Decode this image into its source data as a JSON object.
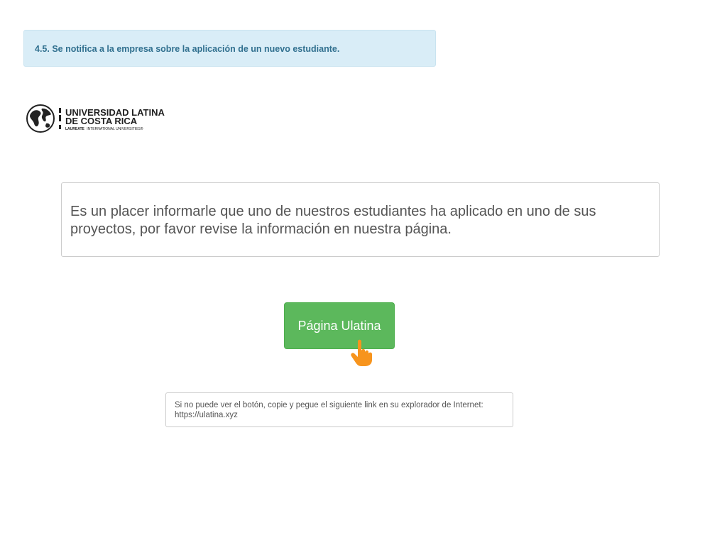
{
  "banner": {
    "text": "4.5. Se notifica a la empresa sobre la aplicación de un nuevo estudiante."
  },
  "logo": {
    "line1": "UNIVERSIDAD LATINA",
    "line2": "DE COSTA RICA",
    "tagline_bold": "LAUREATE",
    "tagline_rest": "INTERNATIONAL UNIVERSITIES®",
    "icon": "globe-icon"
  },
  "message": {
    "text": "Es un placer informarle que uno de nuestros estudiantes ha aplicado en uno de sus proyectos, por favor revise la información en nuestra página."
  },
  "cta": {
    "label": "Página Ulatina",
    "pointer_icon": "hand-pointer-icon",
    "color": "#5cb85c"
  },
  "fallback": {
    "instructions": "Si no puede ver el botón, copie y pegue el siguiente link en su explorador de Internet:",
    "link": "https://ulatina.xyz"
  },
  "colors": {
    "banner_bg": "#d9edf7",
    "banner_text": "#31708f",
    "pointer": "#f7941d"
  }
}
